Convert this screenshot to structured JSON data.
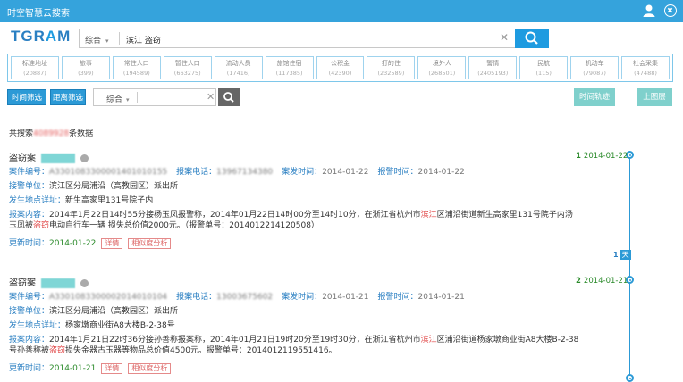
{
  "window": {
    "title": "时空智慧云搜索"
  },
  "logo": {
    "text_a": "TGR",
    "text_b": "A",
    "text_c": "M"
  },
  "search": {
    "scope": "综合",
    "query": "滨江  盗窃"
  },
  "categories": [
    {
      "label": "标准地址",
      "count": "(20887)"
    },
    {
      "label": "旅事",
      "count": "(399)"
    },
    {
      "label": "常住人口",
      "count": "(194589)"
    },
    {
      "label": "暂住人口",
      "count": "(663275)"
    },
    {
      "label": "流动人员",
      "count": "(17416)"
    },
    {
      "label": "旅馆住宿",
      "count": "(117385)"
    },
    {
      "label": "公积金",
      "count": "(42390)"
    },
    {
      "label": "打的住",
      "count": "(232589)"
    },
    {
      "label": "境外人",
      "count": "(268501)"
    },
    {
      "label": "警情",
      "count": "(2405193)"
    },
    {
      "label": "民航",
      "count": "(115)"
    },
    {
      "label": "机动车",
      "count": "(79087)"
    },
    {
      "label": "社会采集",
      "count": "(47488)"
    }
  ],
  "filters": {
    "time_btn": "时间筛选",
    "distance_btn": "距离筛选",
    "scope": "综合",
    "timeline_btn": "时间轨迹",
    "map_btn": "上图层"
  },
  "summary": {
    "prefix": "共搜索",
    "number": "4089928",
    "suffix": "条数据"
  },
  "labels": {
    "case_no": "案件编号：",
    "reporter_phone": "报案电话：",
    "occur_time": "案发时间：",
    "report_time": "报警时间：",
    "unit": "接警单位：",
    "address": "发生地点详址：",
    "content": "报案内容：",
    "update": "更新时间：",
    "detail": "详情",
    "similar": "相似度分析"
  },
  "cases": [
    {
      "title": "盗窃案",
      "case_no": "A3301083300001401010155",
      "phone": "13967134380",
      "occur": "2014-01-22",
      "report": "2014-01-22",
      "unit": "滨江区分局浦沿（高教园区）派出所",
      "address": "新生高家里131号院子内",
      "content_1": "2014年1月22日14时55分接杨玉凤报警称，2014年01月22日14时00分至14时10分，在浙江省杭州市",
      "content_hl": "滨江",
      "content_2": "区浦沿街道新生高家里131号院子内汤",
      "content_3": "玉凤被",
      "content_hl2": "盗窃",
      "content_4": "电动自行车一辆 损失总价值2000元。（报警单号：2014012214120508）",
      "update": "2014-01-22"
    },
    {
      "title": "盗窃案",
      "case_no": "A3301083300002014010104",
      "phone": "13003675602",
      "occur": "2014-01-21",
      "report": "2014-01-21",
      "unit": "滨江区分局浦沿（高教园区）派出所",
      "address": "杨家墩商业街A8大楼B-2-38号",
      "content_1": "2014年1月21日22时36分接孙善称报案称，2014年01月21日19时20分至19时30分，在浙江省杭州市",
      "content_hl": "滨江",
      "content_2": "区浦沿街道杨家墩商业街A8大楼B-2-38",
      "content_3": "号孙善称被",
      "content_hl2": "盗窃",
      "content_4": "损失金器古玉器等物品总价值4500元。报警单号：2014012119551416。",
      "update": "2014-01-21"
    }
  ],
  "timeline": [
    {
      "index": "1",
      "date": "2014-01-22",
      "day_num": "1",
      "day_unit": "天"
    },
    {
      "index": "2",
      "date": "2014-01-21"
    }
  ],
  "colors": {
    "titlebar": "#35a3dc",
    "accent": "#1e9be0",
    "link": "#2a7fc2",
    "highlight": "#e04444",
    "date": "#2a8a2a"
  }
}
